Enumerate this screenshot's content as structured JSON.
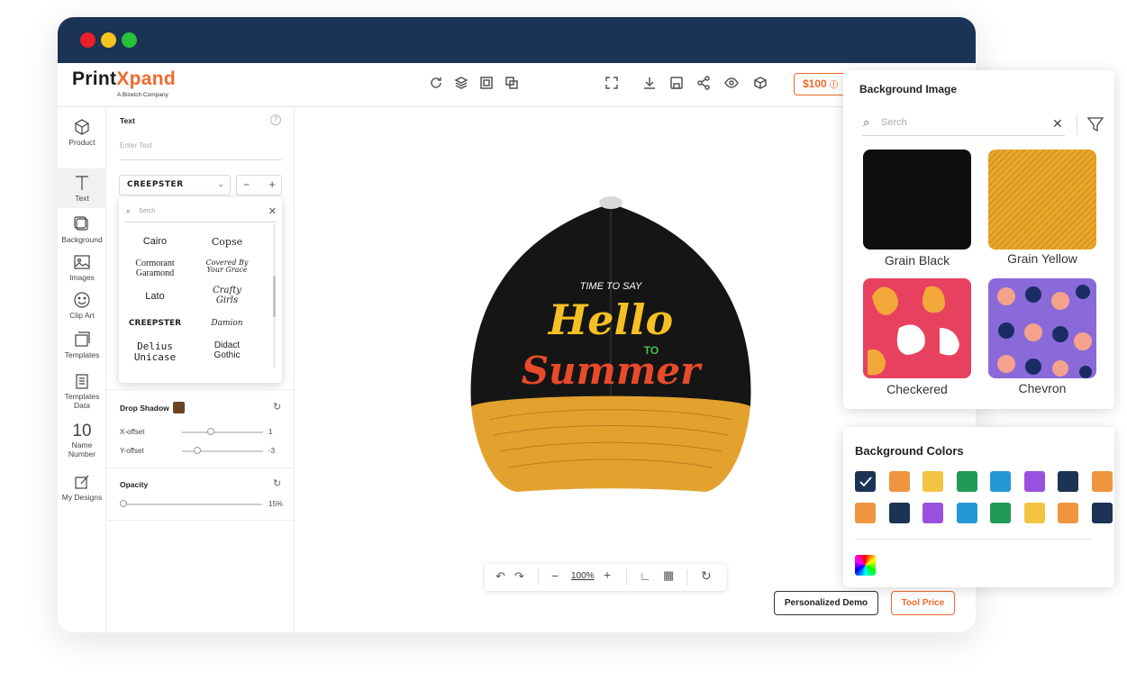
{
  "app": {
    "logo_main": "Print",
    "logo_x": "X",
    "logo_rest": "pand",
    "logo_sub": "A Bizetch Company",
    "price": "$100"
  },
  "rail": [
    {
      "label": "Product"
    },
    {
      "label": "Text"
    },
    {
      "label": "Background"
    },
    {
      "label": "Images"
    },
    {
      "label": "Clip Art"
    },
    {
      "label": "Templates"
    },
    {
      "label": "Templates Data"
    },
    {
      "label": "Name Number",
      "number": "10"
    },
    {
      "label": "My Designs"
    }
  ],
  "panel": {
    "text_label": "Text",
    "text_placeholder": "Enter Text",
    "font_selected": "CREEPSTER",
    "stepper_minus": "−",
    "stepper_plus": "+",
    "font_search_placeholder": "Serch",
    "fonts": [
      "Cairo",
      "Copse",
      "Cormorant Garamond",
      "Covered By Your Grace",
      "Lato",
      "Crafty Girls",
      "CREEPSTER",
      "Damion",
      "Delius Unicase",
      "Didact Gothic"
    ],
    "drop_shadow_label": "Drop Shadow",
    "drop_shadow_color": "#6b4426",
    "x_offset_label": "X-offset",
    "x_offset_value": "1",
    "y_offset_label": "Y-offset",
    "y_offset_value": "-3",
    "opacity_label": "Opacity",
    "opacity_value": "15%"
  },
  "canvas": {
    "design_line1": "TIME TO SAY",
    "design_line2": "Hello",
    "design_line3": "TO",
    "design_line4": "Summer",
    "zoom": "100%",
    "personalized_demo": "Personalized Demo",
    "tool_price": "Tool Price"
  },
  "background_image": {
    "title": "Background Image",
    "search_placeholder": "Serch",
    "tiles": [
      {
        "label": "Grain Black"
      },
      {
        "label": "Grain Yellow"
      },
      {
        "label": "Checkered"
      },
      {
        "label": "Chevron"
      }
    ]
  },
  "background_colors": {
    "title": "Background Colors",
    "row1": [
      "#1b3354",
      "#f0953f",
      "#f3c443",
      "#1f9b55",
      "#2596d6",
      "#9b51e0",
      "#1b3354",
      "#f0953f"
    ],
    "row2": [
      "#f0953f",
      "#1b3354",
      "#9b51e0",
      "#2596d6",
      "#1f9b55",
      "#f3c443",
      "#f0953f",
      "#1b3354"
    ]
  },
  "colors": {
    "accent": "#ef6a2e",
    "navy": "#1b3354"
  }
}
